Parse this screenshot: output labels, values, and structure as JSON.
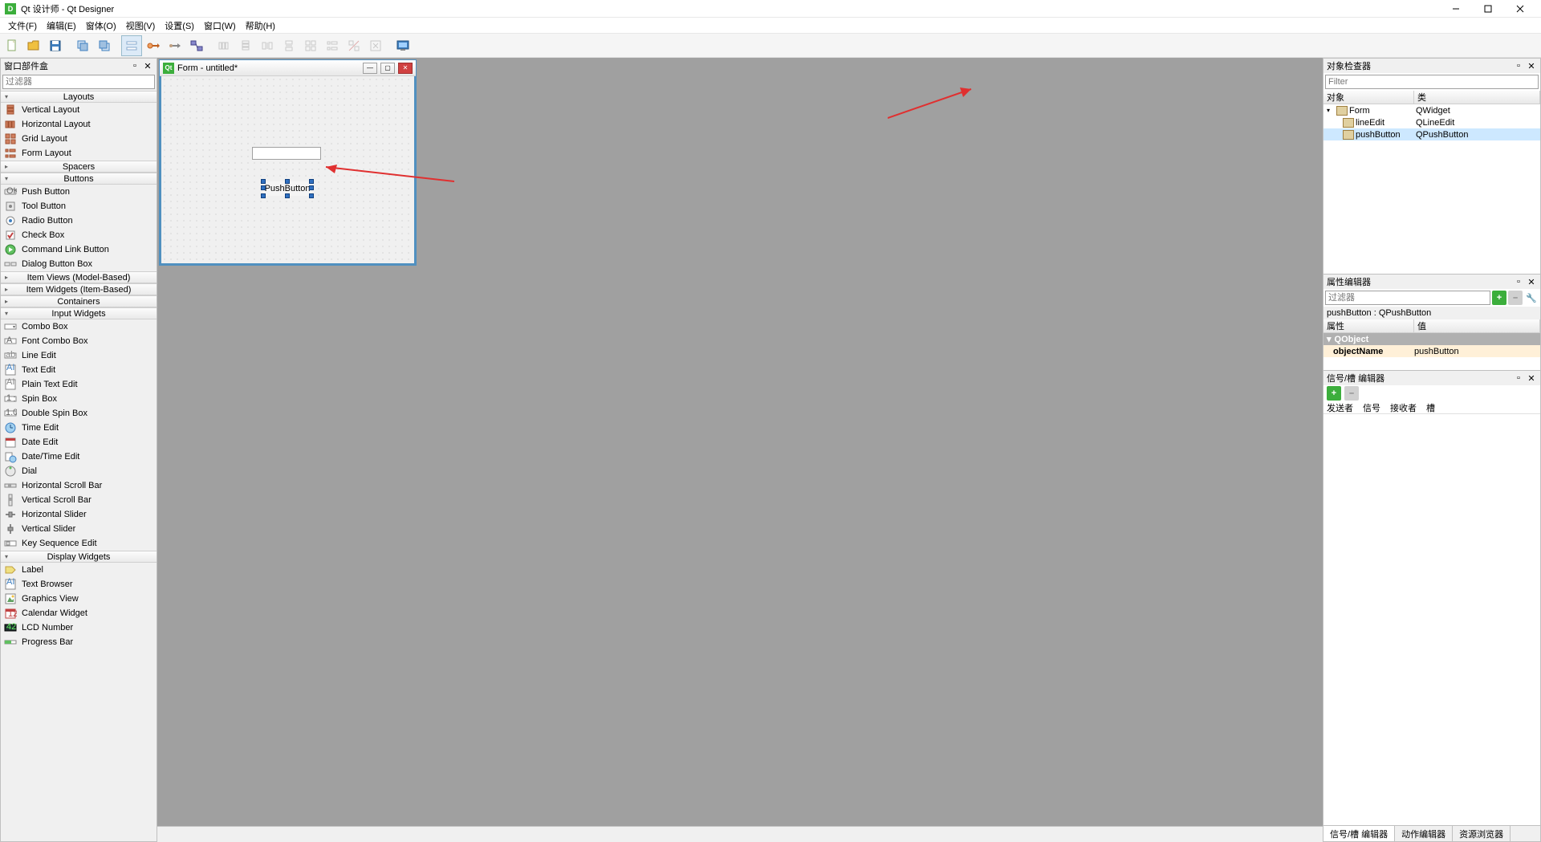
{
  "titlebar": {
    "app_name": "Qt 设计师 - Qt Designer",
    "app_icon_letter": "D"
  },
  "menus": {
    "file": "文件(F)",
    "edit": "编辑(E)",
    "form": "窗体(O)",
    "view": "视图(V)",
    "settings": "设置(S)",
    "window": "窗口(W)",
    "help": "帮助(H)"
  },
  "widgetbox": {
    "title": "窗口部件盒",
    "filter_placeholder": "过滤器",
    "categories": {
      "layouts": "Layouts",
      "spacers": "Spacers",
      "buttons": "Buttons",
      "item_views": "Item Views (Model-Based)",
      "item_widgets": "Item Widgets (Item-Based)",
      "containers": "Containers",
      "input_widgets": "Input Widgets",
      "display_widgets": "Display Widgets"
    },
    "layouts": [
      "Vertical Layout",
      "Horizontal Layout",
      "Grid Layout",
      "Form Layout"
    ],
    "buttons": [
      "Push Button",
      "Tool Button",
      "Radio Button",
      "Check Box",
      "Command Link Button",
      "Dialog Button Box"
    ],
    "input_widgets": [
      "Combo Box",
      "Font Combo Box",
      "Line Edit",
      "Text Edit",
      "Plain Text Edit",
      "Spin Box",
      "Double Spin Box",
      "Time Edit",
      "Date Edit",
      "Date/Time Edit",
      "Dial",
      "Horizontal Scroll Bar",
      "Vertical Scroll Bar",
      "Horizontal Slider",
      "Vertical Slider",
      "Key Sequence Edit"
    ],
    "display_widgets": [
      "Label",
      "Text Browser",
      "Graphics View",
      "Calendar Widget",
      "LCD Number",
      "Progress Bar"
    ]
  },
  "form": {
    "title": "Form - untitled*",
    "button_text": "PushButton"
  },
  "inspector": {
    "title": "对象检查器",
    "col_object": "对象",
    "col_class": "类",
    "rows": [
      {
        "obj": "Form",
        "cls": "QWidget",
        "indent": 0,
        "icon": "form"
      },
      {
        "obj": "lineEdit",
        "cls": "QLineEdit",
        "indent": 1,
        "icon": "le"
      },
      {
        "obj": "pushButton",
        "cls": "QPushButton",
        "indent": 1,
        "icon": "pb",
        "sel": true
      }
    ]
  },
  "prop_editor": {
    "title": "属性编辑器",
    "filter_placeholder": "过滤器",
    "selection": "pushButton : QPushButton",
    "col_property": "属性",
    "col_value": "值",
    "section_qobject": "QObject",
    "prop_objectName": "objectName",
    "val_objectName": "pushButton"
  },
  "signal_editor": {
    "title": "信号/槽 编辑器",
    "col_sender": "发送者",
    "col_signal": "信号",
    "col_receiver": "接收者",
    "col_slot": "槽"
  },
  "bottom_tabs": {
    "sig": "信号/槽 编辑器",
    "act": "动作编辑器",
    "res": "资源浏览器"
  }
}
